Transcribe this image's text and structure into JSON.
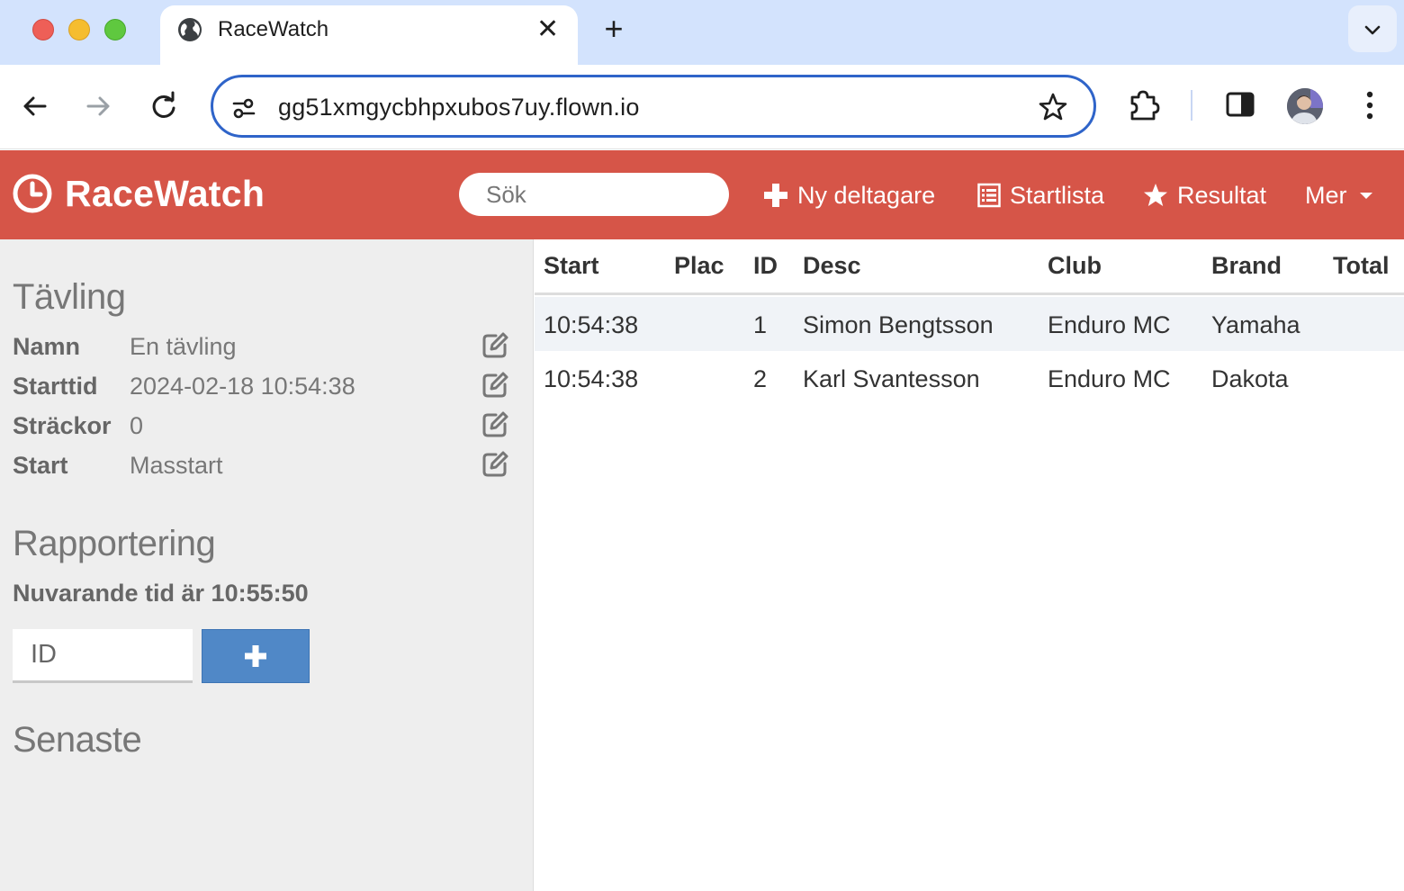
{
  "browser": {
    "tab_title": "RaceWatch",
    "tab_close": "✕",
    "new_tab": "+",
    "url": "gg51xmgycbhpxubos7uy.flown.io"
  },
  "navbar": {
    "brand": "RaceWatch",
    "search_placeholder": "Sök",
    "links": {
      "new_participant": "Ny deltagare",
      "start_list": "Startlista",
      "results": "Resultat",
      "more": "Mer"
    }
  },
  "sidebar": {
    "competition": {
      "title": "Tävling",
      "rows": [
        {
          "label": "Namn",
          "value": "En tävling"
        },
        {
          "label": "Starttid",
          "value": "2024-02-18 10:54:38"
        },
        {
          "label": "Sträckor",
          "value": "0"
        },
        {
          "label": "Start",
          "value": "Masstart"
        }
      ]
    },
    "reporting": {
      "title": "Rapportering",
      "current_time": "Nuvarande tid är 10:55:50",
      "id_placeholder": "ID"
    },
    "latest": {
      "title": "Senaste"
    }
  },
  "table": {
    "headers": [
      "Start",
      "Plac",
      "ID",
      "Desc",
      "Club",
      "Brand",
      "Total"
    ],
    "rows": [
      {
        "start": "10:54:38",
        "plac": "",
        "id": "1",
        "desc": "Simon Bengtsson",
        "club": "Enduro MC",
        "brand": "Yamaha",
        "total": ""
      },
      {
        "start": "10:54:38",
        "plac": "",
        "id": "2",
        "desc": "Karl Svantesson",
        "club": "Enduro MC",
        "brand": "Dakota",
        "total": ""
      }
    ]
  },
  "colors": {
    "navbar": "#d65548",
    "sidebar": "#eeeeee",
    "add_button": "#5088c7",
    "omnibox_focus": "#2f64c9"
  }
}
